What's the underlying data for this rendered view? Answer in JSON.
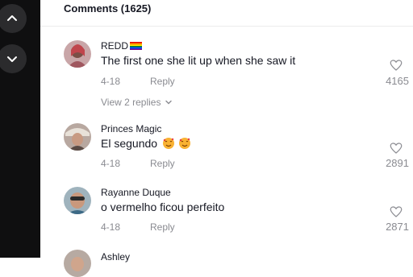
{
  "header": {
    "title": "Comments (1625)"
  },
  "comments": [
    {
      "username": "REDD",
      "username_flag": "rainbow-flag-icon",
      "text": "The first one she lit up when she saw it",
      "date": "4-18",
      "reply_label": "Reply",
      "likes": "4165",
      "view_replies": "View 2 replies"
    },
    {
      "username": "Princes Magic",
      "text": "El segundo",
      "emojis": [
        "smiling-face-with-hearts-icon",
        "smiling-face-with-hearts-icon"
      ],
      "date": "4-18",
      "reply_label": "Reply",
      "likes": "2891"
    },
    {
      "username": "Rayanne Duque",
      "text": "o vermelho ficou perfeito",
      "date": "4-18",
      "reply_label": "Reply",
      "likes": "2871"
    },
    {
      "username": "Ashley"
    }
  ],
  "colors": {
    "text": "#161823",
    "muted": "#8a8b91",
    "left_panel": "#0f0f10"
  }
}
